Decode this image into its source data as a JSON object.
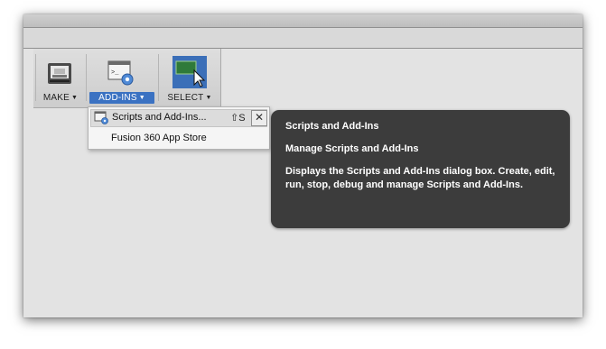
{
  "ribbon": {
    "groups": [
      {
        "label": "MAKE",
        "icon": "printer-icon",
        "active": false
      },
      {
        "label": "ADD-INS",
        "icon": "scripts-gear-icon",
        "active": true
      },
      {
        "label": "SELECT",
        "icon": "select-cursor-icon",
        "active": false
      }
    ],
    "caret": "▼"
  },
  "dropdown": {
    "items": [
      {
        "label": "Scripts and Add-Ins...",
        "shortcut": "⇧S",
        "close": "✕",
        "icon": "scripts-addins-icon"
      },
      {
        "label": "Fusion 360 App Store"
      }
    ]
  },
  "tooltip": {
    "title": "Scripts and Add-Ins",
    "subtitle": "Manage Scripts and Add-Ins",
    "description": "Displays the Scripts and Add-Ins dialog box. Create, edit, run, stop, debug and manage Scripts and Add-Ins."
  },
  "colors": {
    "accent": "#3b72c2",
    "tooltip_bg": "#3c3c3c",
    "window_bg": "#e3e3e3"
  }
}
